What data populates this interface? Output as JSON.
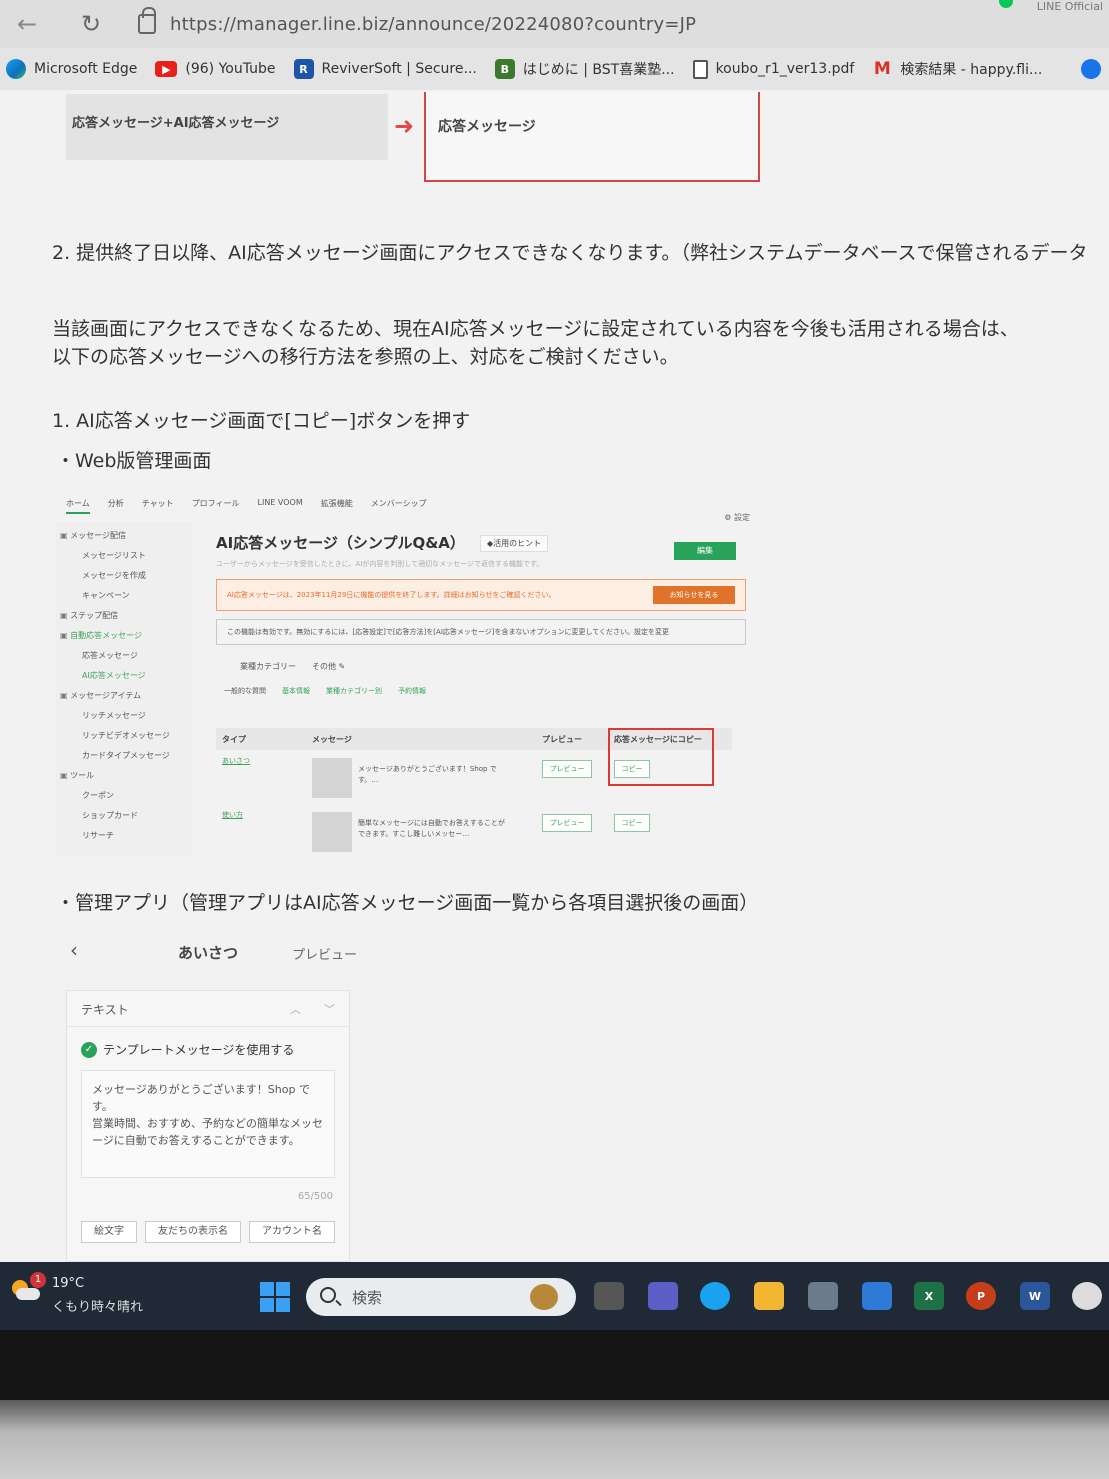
{
  "browser": {
    "url": "https://manager.line.biz/announce/20224080?country=JP",
    "corner_text": "LINE Official",
    "bookmarks": [
      {
        "label": "Microsoft Edge",
        "icon": "edge-icon"
      },
      {
        "label": "(96) YouTube",
        "icon": "youtube-icon"
      },
      {
        "label": "ReviverSoft | Secure...",
        "icon": "reviversoft-icon"
      },
      {
        "label": "はじめに | BST喜業塾...",
        "icon": "bst-icon"
      },
      {
        "label": "koubo_r1_ver13.pdf",
        "icon": "document-icon"
      },
      {
        "label": "検索結果 - happy.fli...",
        "icon": "gmail-icon"
      }
    ]
  },
  "flow": {
    "from": "応答メッセージ+AI応答メッセージ",
    "to": "応答メッセージ"
  },
  "article": {
    "para2": "2. 提供終了日以降、AI応答メッセージ画面にアクセスできなくなります。（弊社システムデータベースで保管されるデータ",
    "para_line1": "当該画面にアクセスできなくなるため、現在AI応答メッセージに設定されている内容を今後も活用される場合は、",
    "para_line2": "以下の応答メッセージへの移行方法を参照の上、対応をご検討ください。",
    "step1": "1. AI応答メッセージ画面で[コピー]ボタンを押す",
    "web_heading": "・Web版管理画面",
    "app_heading": "・管理アプリ（管理アプリはAI応答メッセージ画面一覧から各項目選択後の画面）"
  },
  "web_shot": {
    "tabs": [
      "ホーム",
      "分析",
      "チャット",
      "プロフィール",
      "LINE VOOM",
      "拡張機能",
      "メンバーシップ"
    ],
    "settings": "⚙ 設定",
    "sidebar": [
      {
        "label": "メッセージ配信",
        "kind": "head"
      },
      {
        "label": "メッセージリスト",
        "kind": "child"
      },
      {
        "label": "メッセージを作成",
        "kind": "child"
      },
      {
        "label": "キャンペーン",
        "kind": "child"
      },
      {
        "label": "ステップ配信",
        "kind": "head"
      },
      {
        "label": "自動応答メッセージ",
        "kind": "head-green"
      },
      {
        "label": "応答メッセージ",
        "kind": "child"
      },
      {
        "label": "AI応答メッセージ",
        "kind": "child-green"
      },
      {
        "label": "メッセージアイテム",
        "kind": "head"
      },
      {
        "label": "リッチメッセージ",
        "kind": "child"
      },
      {
        "label": "リッチビデオメッセージ",
        "kind": "child"
      },
      {
        "label": "カードタイプメッセージ",
        "kind": "child"
      },
      {
        "label": "ツール",
        "kind": "head"
      },
      {
        "label": "クーポン",
        "kind": "child"
      },
      {
        "label": "ショップカード",
        "kind": "child"
      },
      {
        "label": "リサーチ",
        "kind": "child"
      }
    ],
    "title": "AI応答メッセージ（シンプルQ&A）",
    "hint": "◆活用のヒント",
    "edit": "編集",
    "desc": "ユーザーからメッセージを受信したときに、AIが内容を判別して適切なメッセージで返信する機能です。",
    "alert": "AI応答メッセージは、2023年11月29日に機能の提供を終了します。詳細はお知らせをご確認ください。",
    "alert_button": "お知らせを見る",
    "info": "この機能は有効です。無効にするには、[応答設定]で[応答方法]を[AI応答メッセージ]を含まないオプションに変更してください。設定を変更",
    "category": "業種カテゴリー　　その他 ✎",
    "subtabs": [
      "一般的な質問",
      "基本情報",
      "業種カテゴリー別",
      "予約情報"
    ],
    "columns": [
      "タイプ",
      "メッセージ",
      "プレビュー",
      "応答メッセージにコピー"
    ],
    "rows": [
      {
        "type": "あいさつ",
        "message": "メッセージありがとうございます！Shop です。…",
        "preview": "プレビュー",
        "copy": "コピー"
      },
      {
        "type": "使い方",
        "message": "簡単なメッセージには自動でお答えすることができます。すこし難しいメッセー…",
        "preview": "プレビュー",
        "copy": "コピー"
      }
    ]
  },
  "app_shot": {
    "back": "‹",
    "title": "あいさつ",
    "preview": "プレビュー",
    "section": "テキスト",
    "use_template": "テンプレートメッセージを使用する",
    "message": "メッセージありがとうございます！Shop です。\n営業時間、おすすめ、予約などの簡単なメッセージに自動でお答えすることができます。",
    "count": "65/500",
    "chips": [
      "絵文字",
      "友だちの表示名",
      "アカウント名"
    ]
  },
  "taskbar": {
    "temperature": "19°C",
    "condition": "くもり時々晴れ",
    "weather_badge": "1",
    "search_placeholder": "検索",
    "apps": [
      {
        "name": "task-view-icon",
        "label": ""
      },
      {
        "name": "teams-icon",
        "label": ""
      },
      {
        "name": "edge-taskbar-icon",
        "label": ""
      },
      {
        "name": "file-explorer-icon",
        "label": ""
      },
      {
        "name": "store-icon",
        "label": ""
      },
      {
        "name": "mail-icon",
        "label": ""
      },
      {
        "name": "excel-icon",
        "label": "X"
      },
      {
        "name": "powerpoint-icon",
        "label": "P"
      },
      {
        "name": "word-icon",
        "label": "W"
      },
      {
        "name": "whatsapp-icon",
        "label": ""
      }
    ]
  },
  "colors": {
    "line_green": "#2aa35a",
    "alert_orange": "#e0722a",
    "highlight_red": "#d63a3a",
    "taskbar": "#1f2a36"
  }
}
